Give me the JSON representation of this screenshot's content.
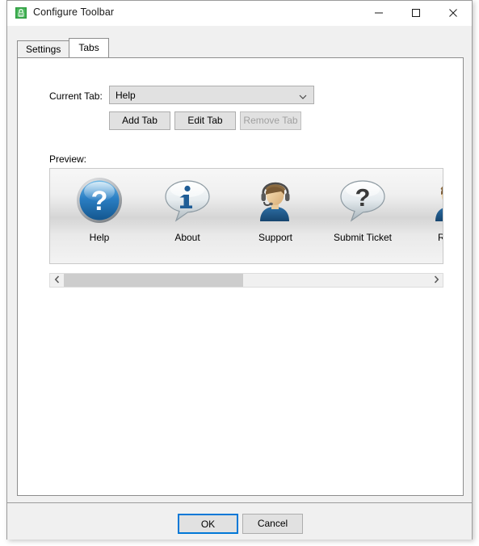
{
  "window": {
    "title": "Configure Toolbar",
    "icon": "app-green-lock-icon",
    "controls": {
      "minimize": "minimize-icon",
      "maximize": "maximize-icon",
      "close": "close-icon"
    }
  },
  "tabs": [
    {
      "label": "Settings",
      "active": false
    },
    {
      "label": "Tabs",
      "active": true
    }
  ],
  "form": {
    "current_tab_label": "Current Tab:",
    "current_tab_value": "Help",
    "current_tab_options": [
      "Help"
    ],
    "dropdown_icon": "chevron-down-icon",
    "buttons": [
      {
        "label": "Add Tab",
        "enabled": true
      },
      {
        "label": "Edit Tab",
        "enabled": true
      },
      {
        "label": "Remove Tab",
        "enabled": false
      }
    ]
  },
  "preview": {
    "label": "Preview:",
    "items": [
      {
        "label": "Help",
        "icon": "question-mark-circle-icon"
      },
      {
        "label": "About",
        "icon": "info-speech-bubble-icon"
      },
      {
        "label": "Support",
        "icon": "headset-person-icon"
      },
      {
        "label": "Submit Ticket",
        "icon": "question-speech-bubble-icon"
      },
      {
        "label": "Remo",
        "icon": "person-icon"
      }
    ]
  },
  "scrollbar": {
    "left_arrow": "chevron-left-icon",
    "right_arrow": "chevron-right-icon",
    "thumb_position_percent": 0,
    "thumb_width_percent": 49
  },
  "footer": {
    "ok_label": "OK",
    "cancel_label": "Cancel"
  },
  "colors": {
    "accent": "#0078d7",
    "window_bg": "#f0f0f0",
    "panel_bg": "#ffffff",
    "border": "#8d8d8d",
    "disabled_text": "#a0a0a0"
  }
}
